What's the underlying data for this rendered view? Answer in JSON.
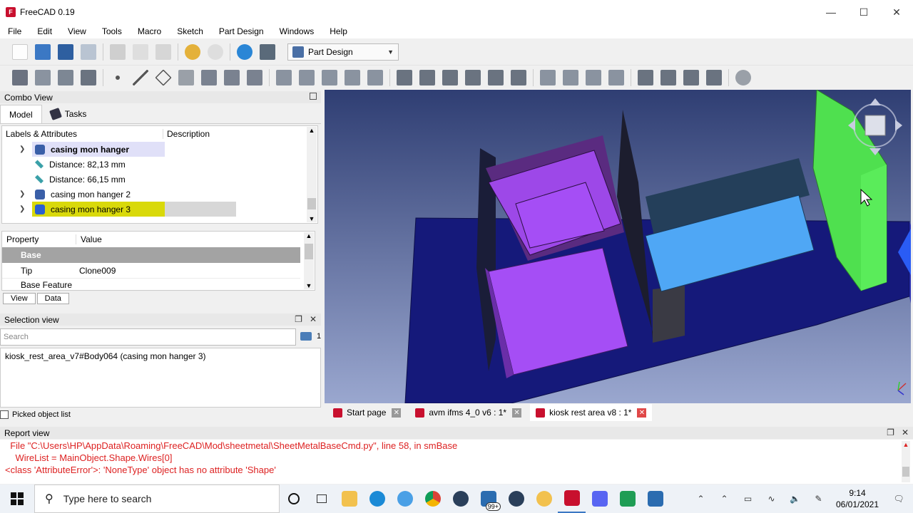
{
  "app": {
    "title": "FreeCAD 0.19"
  },
  "menu": [
    "File",
    "Edit",
    "View",
    "Tools",
    "Macro",
    "Sketch",
    "Part Design",
    "Windows",
    "Help"
  ],
  "workbench": {
    "selected": "Part Design"
  },
  "combo_view": {
    "title": "Combo View",
    "tabs": [
      "Model",
      "Tasks"
    ],
    "tree": {
      "columns": [
        "Labels & Attributes",
        "Description"
      ],
      "rows": [
        {
          "label": "casing mon hanger",
          "icon": "body-icon",
          "expandable": true,
          "bold": true
        },
        {
          "label": "Distance: 82,13 mm",
          "icon": "measure-distance-icon",
          "expandable": false
        },
        {
          "label": "Distance: 66,15 mm",
          "icon": "measure-distance-icon",
          "expandable": false
        },
        {
          "label": "casing mon hanger 2",
          "icon": "body-icon",
          "expandable": true
        },
        {
          "label": "casing mon hanger 3",
          "icon": "body-icon",
          "expandable": true,
          "selected": true
        }
      ]
    },
    "properties": {
      "columns": [
        "Property",
        "Value"
      ],
      "group": "Base",
      "rows": [
        {
          "name": "Tip",
          "value": "Clone009"
        },
        {
          "name": "Base Feature",
          "value": ""
        }
      ],
      "tabs": [
        "View",
        "Data"
      ]
    }
  },
  "selection_view": {
    "title": "Selection view",
    "search_placeholder": "Search",
    "count": "1",
    "items": [
      "kiosk_rest_area_v7#Body064 (casing mon hanger 3)"
    ],
    "picked_label": "Picked object list"
  },
  "documents": [
    {
      "label": "Start page",
      "active": false
    },
    {
      "label": "avm ifms 4_0 v6 : 1*",
      "active": false
    },
    {
      "label": "kiosk rest area v8 : 1*",
      "active": true
    }
  ],
  "report_view": {
    "title": "Report view",
    "lines": [
      "  File \"C:\\Users\\HP\\AppData\\Roaming\\FreeCAD\\Mod\\sheetmetal\\SheetMetalBaseCmd.py\", line 58, in smBase",
      "    WireList = MainObject.Shape.Wires[0]",
      "<class 'AttributeError'>: 'NoneType' object has no attribute 'Shape'"
    ]
  },
  "taskbar": {
    "search_placeholder": "Type here to search",
    "mail_badge": "99+",
    "time": "9:14",
    "date": "06/01/2021"
  },
  "colors": {
    "viewport_bg_top": "#2f3e73",
    "viewport_bg_bottom": "#9aa7cf",
    "base_plate": "#15197a",
    "purple": "#a54ef5",
    "light_blue": "#4fa7f5",
    "green": "#4fe04f",
    "selection_yellow": "#d9d90a",
    "error_red": "#dd2222"
  }
}
